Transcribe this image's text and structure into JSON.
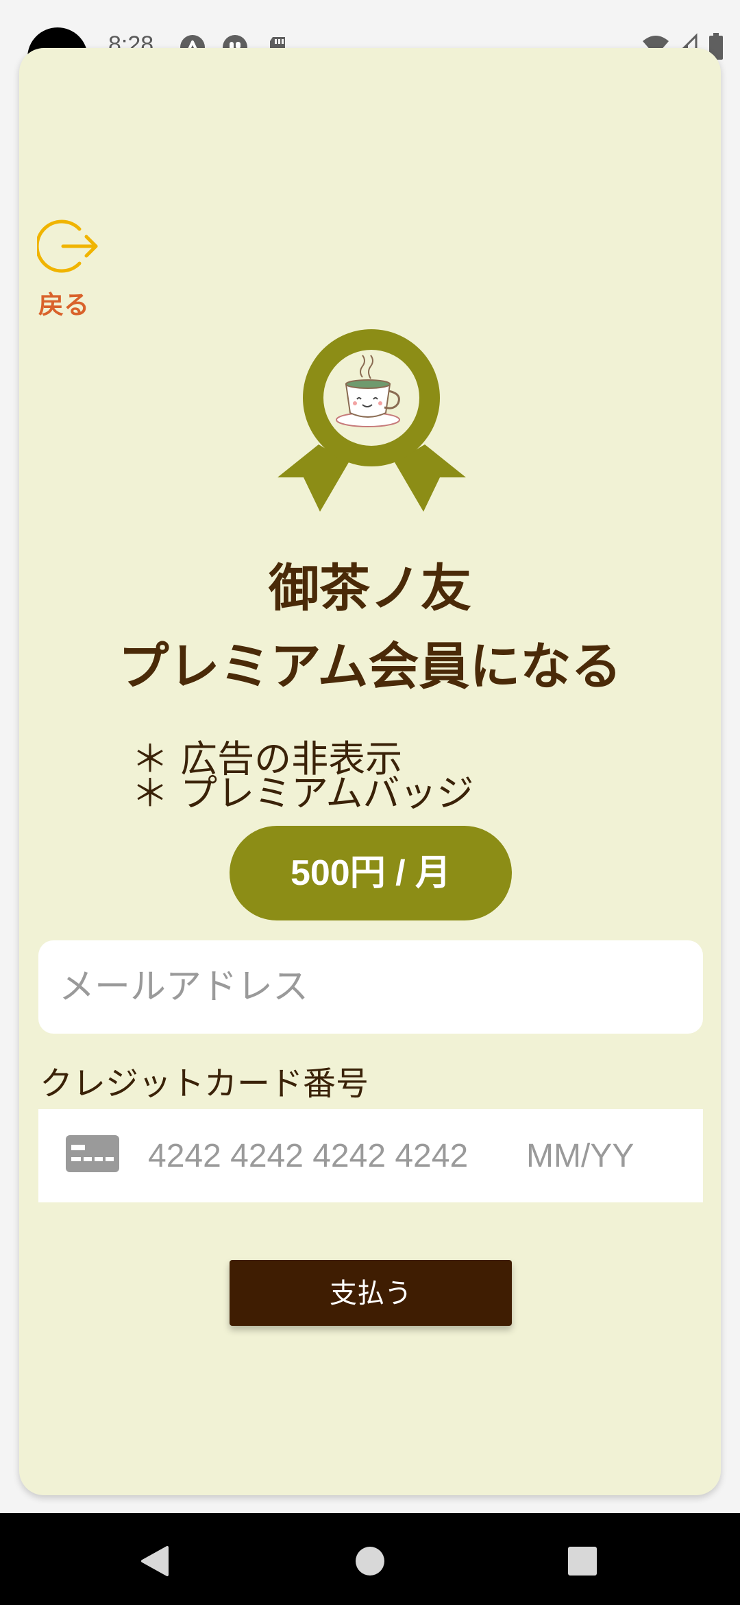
{
  "status_bar": {
    "time": "8:28",
    "left_icons": [
      "a-notification-icon",
      "app-notification-icon",
      "sd-card-icon"
    ],
    "right_icons": [
      "wifi-icon",
      "signal-icon",
      "battery-icon"
    ]
  },
  "header": {
    "back_label": "戻る",
    "back_icon": "logout-arrow-icon"
  },
  "badge": {
    "icon": "tea-cup-ribbon-badge-icon"
  },
  "title": {
    "line1": "御茶ノ友",
    "line2": "プレミアム会員になる"
  },
  "benefits": [
    "＊ 広告の非表示",
    "＊ プレミアムバッジ"
  ],
  "price": {
    "label": "500円 / 月"
  },
  "form": {
    "email_placeholder": "メールアドレス",
    "card_label": "クレジットカード番号",
    "card_number_placeholder": "4242 4242 4242 4242",
    "card_expiry_placeholder": "MM/YY",
    "card_icon": "credit-card-icon"
  },
  "actions": {
    "pay_label": "支払う"
  },
  "nav_bar": {
    "buttons": [
      "back-triangle-icon",
      "home-circle-icon",
      "recents-square-icon"
    ]
  },
  "colors": {
    "card_background": "#f1f2d5",
    "accent_olive": "#8c8d16",
    "text_brown": "#4a2a08",
    "pay_button": "#3f1d02",
    "back_label": "#d9622b",
    "back_icon": "#f0b400"
  }
}
